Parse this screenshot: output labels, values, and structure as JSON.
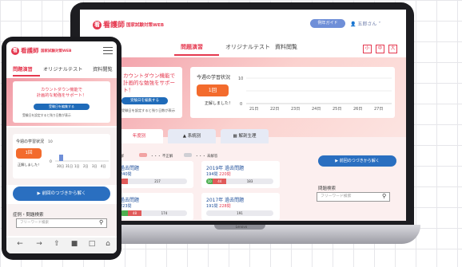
{
  "app": {
    "logo_mark": "看",
    "logo_name": "看護師",
    "logo_sub": "国家試験対策WEB",
    "help_button": "例年ガイド",
    "user_name": "五郎さん",
    "user_icon": "user-icon"
  },
  "font_sizes": [
    "小",
    "中",
    "大"
  ],
  "tabs": [
    "問題演習",
    "オリジナルテスト",
    "資料閲覧"
  ],
  "countdown": {
    "line1": "カウントダウン機能で",
    "line2": "計画的な勉強をサポート！",
    "edit_button": "受験日を編集する",
    "note": "受験日を設定すると残り日数が表示"
  },
  "weekly": {
    "title": "今週の学習状況",
    "times": "1回",
    "correct": "正解しました！",
    "ymax": "10",
    "ymin": "0",
    "days_laptop": [
      "21日",
      "22日",
      "23日",
      "24日",
      "25日",
      "26日",
      "27日"
    ],
    "days_phone": [
      "30日",
      "31日",
      "1日",
      "2日",
      "3日",
      "4日"
    ]
  },
  "subtabs": [
    "年度別",
    "系統別",
    "解剖生理"
  ],
  "legend": {
    "correct": "正解",
    "wrong": "・・・ 不正解",
    "unanswered": "・・・ 未解答"
  },
  "question_cards": [
    {
      "title": "過去問題",
      "count": "240問",
      "correct": "",
      "wrong": "",
      "unanswered": "217"
    },
    {
      "title": "2019年 過去問題",
      "count": "194問",
      "highlight": "220問",
      "correct": "10",
      "wrong": "44",
      "unanswered": "183"
    },
    {
      "title": "過去問題",
      "count": "223問",
      "correct": "",
      "wrong": "48",
      "unanswered": "174"
    },
    {
      "title": "2017年 過去問題",
      "count": "191問",
      "highlight": "228問",
      "correct": "",
      "wrong": "",
      "unanswered": "191"
    }
  ],
  "resume_button": "前回のつづきから解く",
  "search": {
    "label_laptop": "問題検索",
    "label_phone": "症例・問題検索",
    "placeholder": "フリーワード検索"
  },
  "laptop_brand": "Lenovo",
  "colors": {
    "brand": "#e5384f",
    "accent_blue": "#2a6fc0",
    "badge_orange": "#f36b2d",
    "correct_green": "#4caf50",
    "wrong_red": "#e05a5a"
  }
}
